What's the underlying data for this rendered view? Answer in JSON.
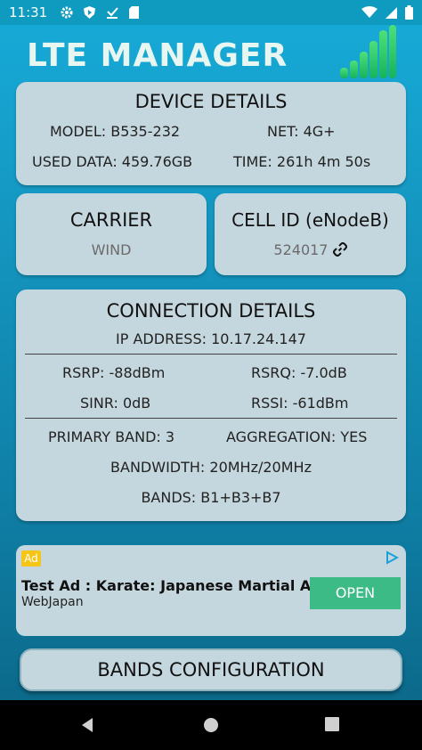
{
  "status_bar": {
    "time": "11:31",
    "left_icons": [
      "gear-icon",
      "shield-play-icon",
      "download-done-icon",
      "sd-card-icon"
    ],
    "right_icons": [
      "wifi-icon",
      "cell-signal-icon",
      "battery-icon"
    ]
  },
  "app": {
    "title": "LTE MANAGER",
    "background_color": "#1496c0",
    "card_color": "#c5d7de"
  },
  "device_details": {
    "title": "DEVICE DETAILS",
    "model": "MODEL: B535-232",
    "net": "NET: 4G+",
    "used_data": "USED DATA: 459.76GB",
    "time": "TIME: 261h 4m 50s"
  },
  "carrier": {
    "title": "CARRIER",
    "value": "WIND"
  },
  "cell_id": {
    "title": "CELL ID (eNodeB)",
    "value": "524017",
    "link_icon": "link-icon"
  },
  "connection_details": {
    "title": "CONNECTION DETAILS",
    "ip_address": "IP ADDRESS: 10.17.24.147",
    "rsrp": "RSRP: -88dBm",
    "rsrq": "RSRQ: -7.0dB",
    "sinr": "SINR: 0dB",
    "rssi": "RSSI: -61dBm",
    "primary_band": "PRIMARY BAND: 3",
    "aggregation": "AGGREGATION: YES",
    "bandwidth": "BANDWIDTH: 20MHz/20MHz",
    "bands": "BANDS: B1+B3+B7"
  },
  "ad": {
    "badge": "Ad",
    "title": "Test Ad : Karate: Japanese Martial Art",
    "advertiser": "WebJapan",
    "cta": "OPEN",
    "cta_color": "#3dbb87"
  },
  "bands_button": {
    "label": "BANDS CONFIGURATION"
  },
  "nav_bar": {
    "buttons": [
      "back-icon",
      "home-icon",
      "recents-icon"
    ]
  }
}
